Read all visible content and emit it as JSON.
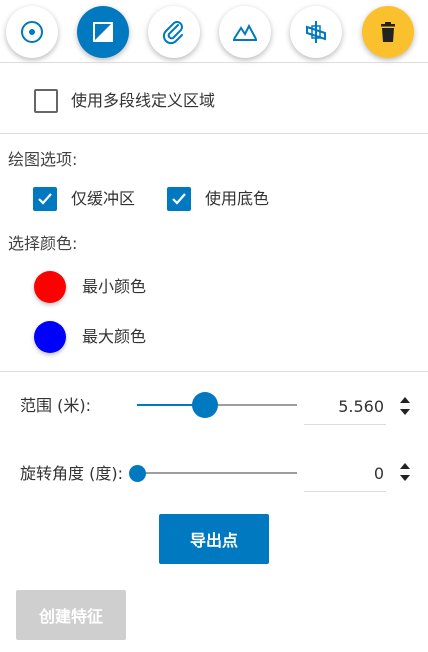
{
  "toolbar": {
    "buttons": [
      {
        "icon": "point-icon"
      },
      {
        "icon": "polygon-icon",
        "active": true
      },
      {
        "icon": "paperclip-icon"
      },
      {
        "icon": "mountain-icon"
      },
      {
        "icon": "plane-icon"
      },
      {
        "icon": "trash-icon",
        "danger": true
      }
    ]
  },
  "polyline_option": {
    "label": "使用多段线定义区域",
    "checked": false
  },
  "drawing_options": {
    "title": "绘图选项:",
    "buffer_only": {
      "label": "仅缓冲区",
      "checked": true
    },
    "use_base_color": {
      "label": "使用底色",
      "checked": true
    }
  },
  "color_selection": {
    "title": "选择颜色:",
    "min_color": {
      "label": "最小颜色",
      "color": "#ff0000"
    },
    "max_color": {
      "label": "最大颜色",
      "color": "#0000ff"
    }
  },
  "range": {
    "label": "范围 (米):",
    "value": "5.560",
    "slider_fraction": 0.43
  },
  "rotation": {
    "label": "旋转角度 (度):",
    "value": "0",
    "slider_fraction": 0.0
  },
  "actions": {
    "export_points": "导出点",
    "create_feature": "创建特征"
  },
  "colors": {
    "accent": "#0079c1",
    "danger": "#fbc02d",
    "disabled": "#cfcfcf"
  }
}
